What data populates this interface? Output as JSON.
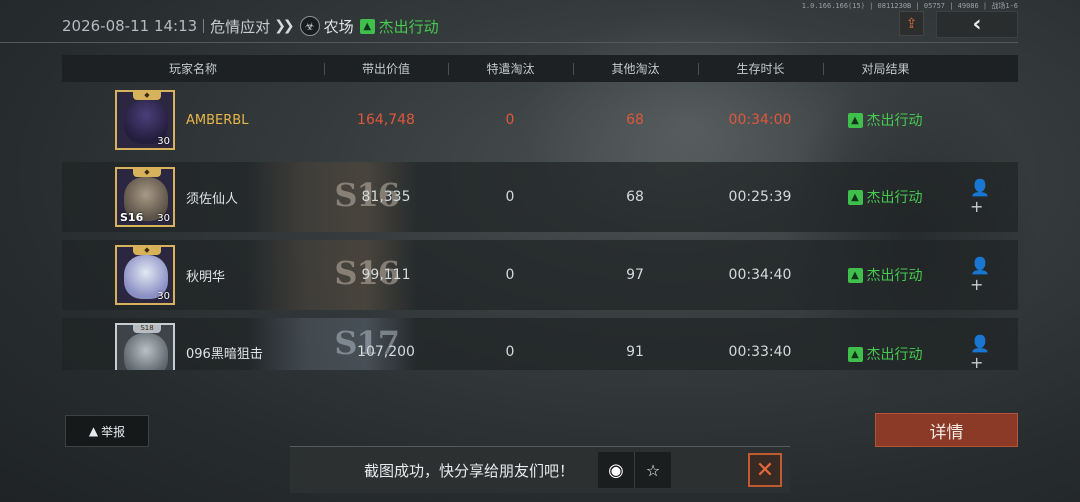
{
  "header": {
    "date": "2026-08-11 14:13",
    "mode": "危情应对",
    "map_icon": "biohazard-icon",
    "map": "农场",
    "result": "杰出行动",
    "id_line": "1.0.166.166(15) | 0811230B | 05757 | 49086 | 战场1-6"
  },
  "table": {
    "columns": [
      "玩家名称",
      "带出价值",
      "特遣淘汰",
      "其他淘汰",
      "生存时长",
      "对局结果"
    ],
    "rows": [
      {
        "name": "AMBERBL",
        "value": "164,748",
        "special": "0",
        "other": "68",
        "time": "00:34:00",
        "result": "杰出行动",
        "level": "30",
        "season": "",
        "frame": "gold",
        "is_self": true
      },
      {
        "name": "须佐仙人",
        "value": "81,335",
        "special": "0",
        "other": "68",
        "time": "00:25:39",
        "result": "杰出行动",
        "level": "30",
        "season": "S16",
        "frame": "gold",
        "is_self": false
      },
      {
        "name": "秋明华",
        "value": "99,111",
        "special": "0",
        "other": "97",
        "time": "00:34:40",
        "result": "杰出行动",
        "level": "30",
        "season": "S16",
        "frame": "gold",
        "is_self": false
      },
      {
        "name": "096黑暗狙击",
        "value": "107,200",
        "special": "0",
        "other": "91",
        "time": "00:33:40",
        "result": "杰出行动",
        "level": "",
        "season": "S17",
        "frame": "silver",
        "is_self": false
      }
    ]
  },
  "buttons": {
    "report": "举报",
    "detail": "详情"
  },
  "toast": {
    "message": "截图成功，快分享给朋友们吧！"
  },
  "colors": {
    "accent_green": "#46c94f",
    "self_name": "#e9b64a",
    "self_stats": "#e0573a",
    "detail_button": "#8a3a26"
  }
}
